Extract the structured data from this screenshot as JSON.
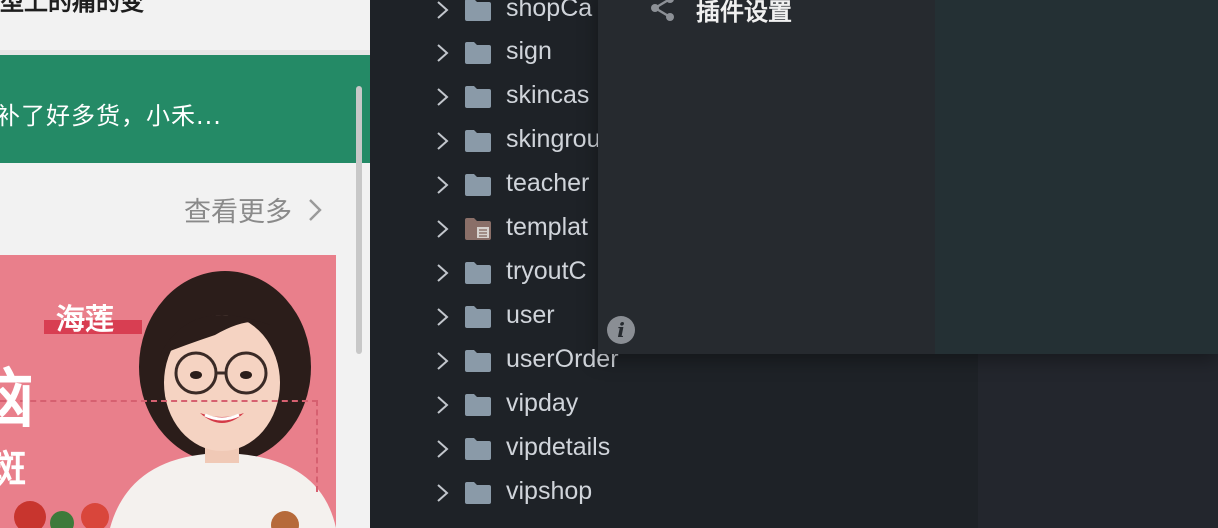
{
  "preview": {
    "top_text": "型上的痛的变",
    "banner_text": "补了好多货，小禾...",
    "see_more": "查看更多",
    "poster": {
      "name": "海莲",
      "big_text_1": "恼",
      "big_text_2": "斑"
    }
  },
  "overlay": {
    "title": "插件设置",
    "share_icon": "share-icon",
    "info_icon_glyph": "i"
  },
  "explorer": {
    "folders": [
      {
        "label": "shopCa",
        "type": "folder"
      },
      {
        "label": "sign",
        "type": "folder"
      },
      {
        "label": "skincas",
        "type": "folder"
      },
      {
        "label": "skingrou",
        "type": "folder"
      },
      {
        "label": "teacher",
        "type": "folder"
      },
      {
        "label": "templat",
        "type": "template-folder"
      },
      {
        "label": "tryoutC",
        "type": "folder"
      },
      {
        "label": "user",
        "type": "folder"
      },
      {
        "label": "userOrder",
        "type": "folder"
      },
      {
        "label": "vipday",
        "type": "folder"
      },
      {
        "label": "vipdetails",
        "type": "folder"
      },
      {
        "label": "vipshop",
        "type": "folder"
      }
    ]
  },
  "colors": {
    "banner_green": "#248a66",
    "folder_gray": "#8a9aa8",
    "template_folder": "#8a6f68",
    "explorer_bg": "#1e2227",
    "overlay_bg": "#262a2f"
  }
}
